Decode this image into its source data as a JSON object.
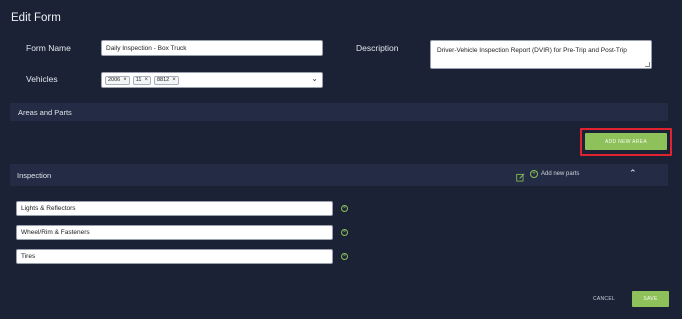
{
  "page": {
    "title": "Edit Form"
  },
  "form": {
    "name_label": "Form Name",
    "name_value": "Daily Inspection - Box Truck",
    "description_label": "Description",
    "description_value": "Driver-Vehicle Inspection Report (DVIR) for Pre-Trip and Post-Trip",
    "vehicles_label": "Vehicles",
    "vehicles": [
      "2006",
      "11",
      "8812"
    ]
  },
  "areas": {
    "section_label": "Areas and Parts",
    "add_area_label": "ADD NEW AREA",
    "area_name": "Inspection",
    "add_parts_label": "Add new parts",
    "parts": [
      "Lights & Reflectors",
      "Wheel/Rim & Fasteners",
      "Tires"
    ]
  },
  "footer": {
    "cancel_label": "CANCEL",
    "save_label": "SAVE"
  },
  "colors": {
    "background": "#1b2236",
    "band": "#232c44",
    "accent": "#8fc15a",
    "highlight": "#e0232e"
  }
}
